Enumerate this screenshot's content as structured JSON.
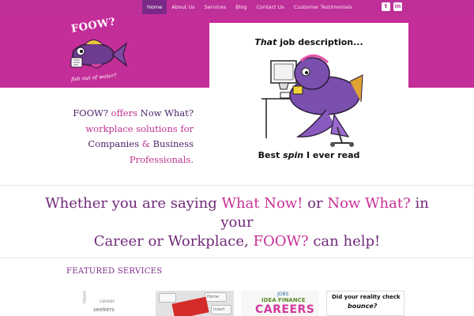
{
  "nav": {
    "items": [
      {
        "label": "Home",
        "active": true
      },
      {
        "label": "About Us",
        "active": false
      },
      {
        "label": "Services",
        "active": false
      },
      {
        "label": "Blog",
        "active": false
      },
      {
        "label": "Contact Us",
        "active": false
      },
      {
        "label": "Customer Testimonials",
        "active": false
      }
    ],
    "social": {
      "twitter": "t",
      "linkedin": "in"
    }
  },
  "logo": {
    "title": "FOOW?",
    "subtitle": "fish out of water?"
  },
  "cartoon": {
    "title_em": "That",
    "title_rest": " job description...",
    "caption_pre": "Best ",
    "caption_em": "spin",
    "caption_post": " I ever read"
  },
  "intro": {
    "p1": "FOOW?",
    "p2": " offers ",
    "p3": "Now What?",
    "p4": "workplace solutions for",
    "p5": "Companies",
    "p6": " & ",
    "p7": "Business",
    "p8": "Professionals."
  },
  "tagline": {
    "a": "Whether you are saying ",
    "b": "What Now!",
    "c": " or ",
    "d": "Now What?",
    "e": " in your",
    "f": "Career or Workplace, ",
    "g": "FOOW?",
    "h": " can help!"
  },
  "featured": {
    "heading": "FEATURED SERVICES"
  },
  "thumbs": {
    "t1": {
      "w1": "seekers",
      "w2": "career",
      "w3": "resume"
    },
    "t2": {
      "w1": "Home",
      "w2": "Insert"
    },
    "t3": {
      "jobs": "JOBS",
      "idea": "IDEA FINANCE",
      "careers": "CAREERS"
    },
    "t4": {
      "line1": "Did your reality check",
      "line2": "bounce?"
    }
  },
  "colors": {
    "brand_pink": "#c42e99",
    "nav_active": "#7a2a86",
    "heading_purple": "#702a78"
  }
}
